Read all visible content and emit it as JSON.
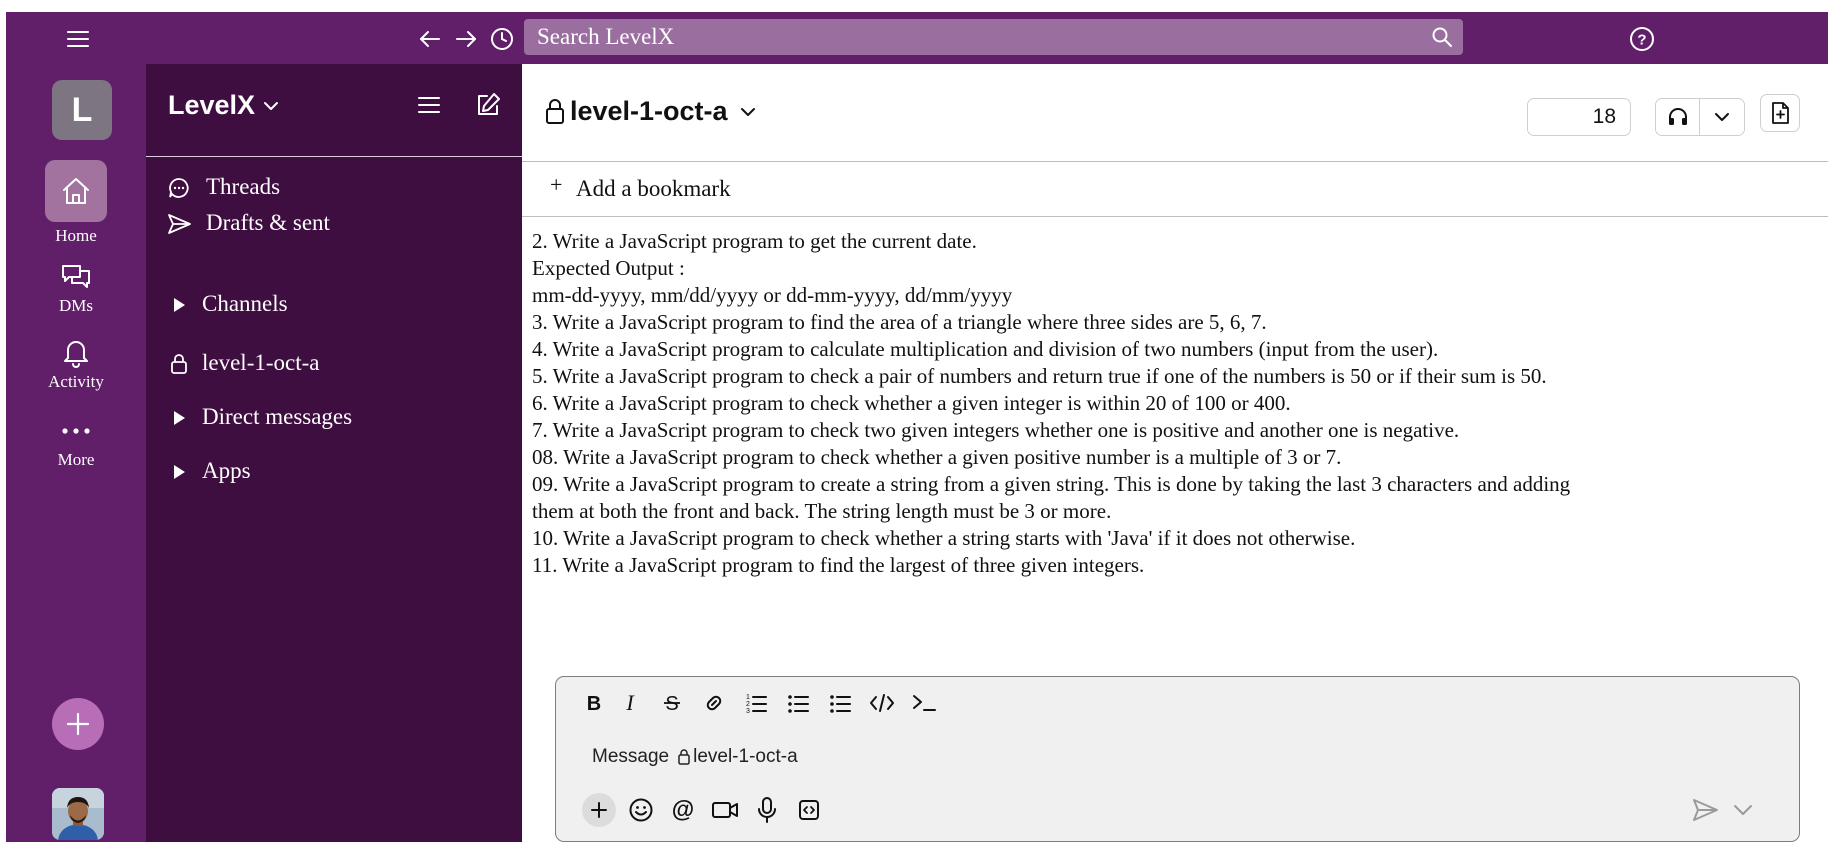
{
  "topbar": {
    "search_placeholder": "Search LevelX"
  },
  "rail": {
    "workspace_initial": "L",
    "home_label": "Home",
    "dms_label": "DMs",
    "activity_label": "Activity",
    "more_label": "More"
  },
  "sidebar": {
    "workspace_name": "LevelX",
    "threads_label": "Threads",
    "drafts_label": "Drafts & sent",
    "channels_label": "Channels",
    "channel_label": "level-1-oct-a",
    "dms_label": "Direct messages",
    "apps_label": "Apps"
  },
  "channel": {
    "name": "level-1-oct-a",
    "member_count": "18",
    "bookmark_label": "Add a bookmark"
  },
  "messages": [
    "2. Write a JavaScript program to get the current date.",
    "Expected Output :",
    "mm-dd-yyyy, mm/dd/yyyy or dd-mm-yyyy, dd/mm/yyyy",
    "3. Write a JavaScript program to find the area of a triangle where three sides are 5, 6, 7.",
    "4. Write a JavaScript program to calculate multiplication and division of two numbers (input from the user).",
    "5. Write a JavaScript program to check a pair of numbers and return true if one of the numbers is 50 or if their sum is 50.",
    "6. Write a JavaScript program to check whether a given integer is within 20 of 100 or 400.",
    "7. Write a JavaScript program to check two given integers whether one is positive and another one is negative.",
    "08. Write a JavaScript program to check whether a given positive number is a multiple of 3 or 7.",
    "09. Write a JavaScript program to create a string from a given string. This is done by taking the last 3 characters and adding",
    "them at both the front and back. The string length must be 3 or more.",
    "10. Write a JavaScript program to check whether a string starts with 'Java' if it does not otherwise.",
    "11. Write a JavaScript program to find the largest of three given integers."
  ],
  "composer": {
    "placeholder_prefix": "Message",
    "placeholder_channel": "level-1-oct-a"
  },
  "colors": {
    "workspace_bg": "#611f69",
    "sidebar_bg": "#3f0e40",
    "search_bg": "#9a6fa0",
    "home_active_bg": "#a3739f",
    "add_button_bg": "#b76eb7"
  }
}
